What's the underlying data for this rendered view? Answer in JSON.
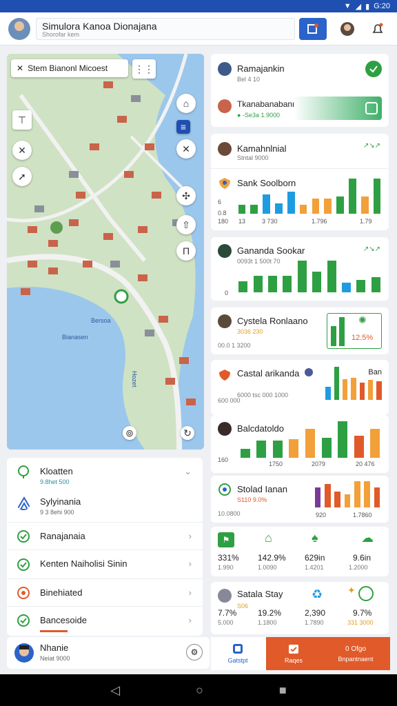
{
  "status": {
    "time": "G:20"
  },
  "header": {
    "title": "Simulora Kanoa Dionajana",
    "subtitle": "Shorofar kem"
  },
  "map": {
    "search_text": "Stem Bianonl Micoest",
    "labels": [
      "Bersoa",
      "Bianasen",
      "Hozet"
    ]
  },
  "list": {
    "items": [
      {
        "title": "Kloatten",
        "sub": "9.8het 500",
        "icon": "marker-icon"
      },
      {
        "title": "Sylyinania",
        "sub": "9 3 8ehi 900",
        "icon": "mountain-icon"
      },
      {
        "title": "Ranajanaia",
        "sub": "",
        "icon": "check-icon"
      },
      {
        "title": "Kenten Naiholisi Sinin",
        "sub": "",
        "icon": "check-icon"
      },
      {
        "title": "Binehiated",
        "sub": "",
        "icon": "target-icon"
      },
      {
        "title": "Bancesoide",
        "sub": "",
        "icon": "check-icon"
      }
    ]
  },
  "profile": {
    "name": "Nhanie",
    "sub": "Neiat 9000"
  },
  "cards": {
    "c1": {
      "title": "Ramajankin",
      "sub": "Bel 4 10"
    },
    "c2": {
      "title": "Tkanabanabanne",
      "sub": "● -Se3a 1.9000"
    },
    "c3": {
      "title": "Kamahnlnial",
      "sub": "Stntal 9000",
      "arrows": "↗↘↗"
    },
    "c4": {
      "title": "Sank Soolborn",
      "yticks": [
        "6",
        "0.8"
      ],
      "xticks": [
        "180",
        "13",
        "3 730",
        "1.796",
        "1.79"
      ]
    },
    "c5": {
      "title": "Gananda Sookar",
      "sub": "0093t 1 500t 70",
      "yticks": [
        "0"
      ],
      "arrows": "↗↘↗"
    },
    "c6": {
      "title": "Cystela Ronlaano",
      "sub": "3036 230",
      "foot": "00.0 1 3200",
      "badge": "12.5%"
    },
    "c7": {
      "title": "Castal arikanda",
      "sub": "6000 tsc 000 1000",
      "corner": "Ban",
      "foot": "600 000"
    },
    "c8": {
      "title": "Balcdatoldo",
      "xticks": [
        "160",
        "1750",
        "2079",
        "20 476"
      ]
    },
    "c9": {
      "title": "Stolad Ianan",
      "sub": "S110 9.0%",
      "foot": "10.0800",
      "xticks": [
        "920",
        "1.7860"
      ]
    },
    "c10": {
      "stats": [
        {
          "value": "331%",
          "sub": "1.990",
          "icon": "flag-icon",
          "color": "#2ea043"
        },
        {
          "value": "142.9%",
          "sub": "1.0090",
          "icon": "house-icon",
          "color": "#2ea043"
        },
        {
          "value": "629in",
          "sub": "1.4201",
          "icon": "tree-icon",
          "color": "#2ea043"
        },
        {
          "value": "9.6in",
          "sub": "1.2000",
          "icon": "cloud-icon",
          "color": "#2ea043"
        }
      ]
    },
    "c11": {
      "title": "Satala Stay",
      "stats": [
        {
          "value": "7.7%",
          "sub": "5.000",
          "hi": "S06"
        },
        {
          "value": "19.2%",
          "sub": "1.1800"
        },
        {
          "value": "2,390",
          "sub": "1.7890"
        },
        {
          "value": "9.7%",
          "sub": "331 3000"
        }
      ]
    }
  },
  "tabs": [
    {
      "label": "Gatstpt",
      "active": true
    },
    {
      "label": "Raqes",
      "active": false
    },
    {
      "label": "Bnpantnaent",
      "active": false,
      "top": "0 Ofgo"
    }
  ],
  "colors": {
    "accent": "#1f4fb0",
    "green": "#2ea043",
    "orange": "#f2a03a",
    "blue": "#1f9ce0",
    "red": "#e05a2a",
    "purple": "#7a3a9a"
  },
  "chart_data": [
    {
      "type": "bar",
      "title": "Sank Soolborn",
      "values": [
        18,
        18,
        38,
        20,
        44,
        18,
        30,
        30,
        34,
        70,
        34,
        70
      ],
      "colors": [
        "#2ea043",
        "#2ea043",
        "#1f9ce0",
        "#1f9ce0",
        "#1f9ce0",
        "#f2a03a",
        "#f2a03a",
        "#f2a03a",
        "#2ea043",
        "#2ea043",
        "#f2a03a",
        "#2ea043"
      ]
    },
    {
      "type": "bar",
      "title": "Gananda Sookar",
      "values": [
        16,
        24,
        24,
        24,
        46,
        30,
        46,
        14,
        18,
        22
      ],
      "colors": [
        "#2ea043",
        "#2ea043",
        "#2ea043",
        "#2ea043",
        "#2ea043",
        "#2ea043",
        "#2ea043",
        "#1f9ce0",
        "#2ea043",
        "#2ea043"
      ]
    },
    {
      "type": "bar",
      "title": "Cystela Ronlaano",
      "values": [
        30,
        44
      ],
      "colors": [
        "#2ea043",
        "#2ea043"
      ]
    },
    {
      "type": "bar",
      "title": "Castal arikanda",
      "values": [
        20,
        50,
        32,
        34,
        26,
        30,
        28
      ],
      "colors": [
        "#1f9ce0",
        "#2ea043",
        "#f2a03a",
        "#f2a03a",
        "#e05a2a",
        "#f2a03a",
        "#e05a2a"
      ]
    },
    {
      "type": "bar",
      "title": "Balcdatoldo",
      "values": [
        14,
        26,
        26,
        28,
        44,
        30,
        56,
        34,
        44
      ],
      "colors": [
        "#2ea043",
        "#2ea043",
        "#2ea043",
        "#f2a03a",
        "#f2a03a",
        "#2ea043",
        "#2ea043",
        "#e05a2a",
        "#f2a03a"
      ]
    },
    {
      "type": "bar",
      "title": "Stolad Ianan",
      "values": [
        30,
        36,
        24,
        20,
        40,
        40,
        30
      ],
      "colors": [
        "#7a3a9a",
        "#e05a2a",
        "#e05a2a",
        "#f2a03a",
        "#f2a03a",
        "#f2a03a",
        "#e05a2a"
      ]
    }
  ]
}
